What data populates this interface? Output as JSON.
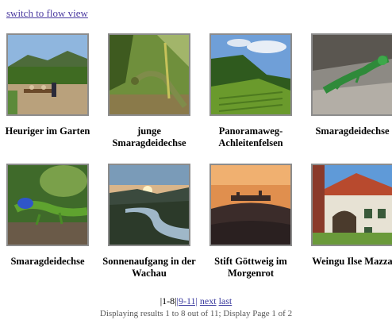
{
  "header": {
    "switch_link": "switch to flow view"
  },
  "gallery": {
    "items": [
      {
        "caption": "Heuriger im Garten",
        "image": "garden-tavern-photo"
      },
      {
        "caption": "junge Smaragdeidechse",
        "image": "young-lizard-photo"
      },
      {
        "caption": "Panoramaweg-Achleitenfelsen",
        "image": "vineyard-panorama-photo"
      },
      {
        "caption": "Smaragdeidechse",
        "image": "lizard-on-rock-photo"
      },
      {
        "caption": "Smaragdeidechse",
        "image": "blue-lizard-photo"
      },
      {
        "caption": "Sonnenaufgang in der Wachau",
        "image": "sunrise-river-photo"
      },
      {
        "caption": "Stift Göttweig im Morgenrot",
        "image": "abbey-dawn-photo"
      },
      {
        "caption": "Weingu Ilse Mazza",
        "image": "winery-house-photo"
      }
    ]
  },
  "pagination": {
    "current": "|1-8|",
    "next_range": "|9-11|",
    "next": "next",
    "last": "last",
    "status": "Displaying results 1 to 8 out of 11; Display Page 1 of 2"
  }
}
